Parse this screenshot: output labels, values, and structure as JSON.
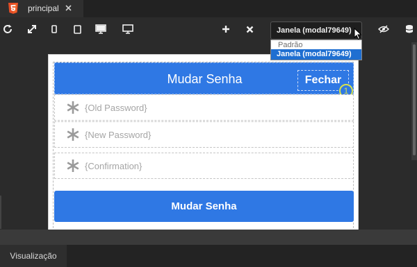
{
  "tab": {
    "label": "principal",
    "icon": "html5-icon",
    "close_icon": "close-icon"
  },
  "toolbar": {
    "buttons": [
      "refresh-icon",
      "expand-icon",
      "mobile-icon",
      "tablet-icon",
      "desktop-icon",
      "monitor-icon",
      "add-icon",
      "remove-icon",
      "eye-slash-icon",
      "database-icon"
    ],
    "select": {
      "value": "Janela (modal79649)",
      "options": [
        {
          "label": "Padrão",
          "kind": "group"
        },
        {
          "label": "Janela (modal79649)",
          "kind": "selected"
        }
      ]
    }
  },
  "modal": {
    "title": "Mudar Senha",
    "close_label": "Fechar",
    "badge": "1",
    "fields": [
      {
        "placeholder": "{Old Password}"
      },
      {
        "placeholder": "{New Password}"
      },
      {
        "placeholder": "{Confirmation}"
      }
    ],
    "submit_label": "Mudar Senha"
  },
  "bottom": {
    "tab_label": "Visualização"
  },
  "colors": {
    "accent": "#2f78e4",
    "selection": "#1f6fd1",
    "background": "#2b2b2b"
  }
}
